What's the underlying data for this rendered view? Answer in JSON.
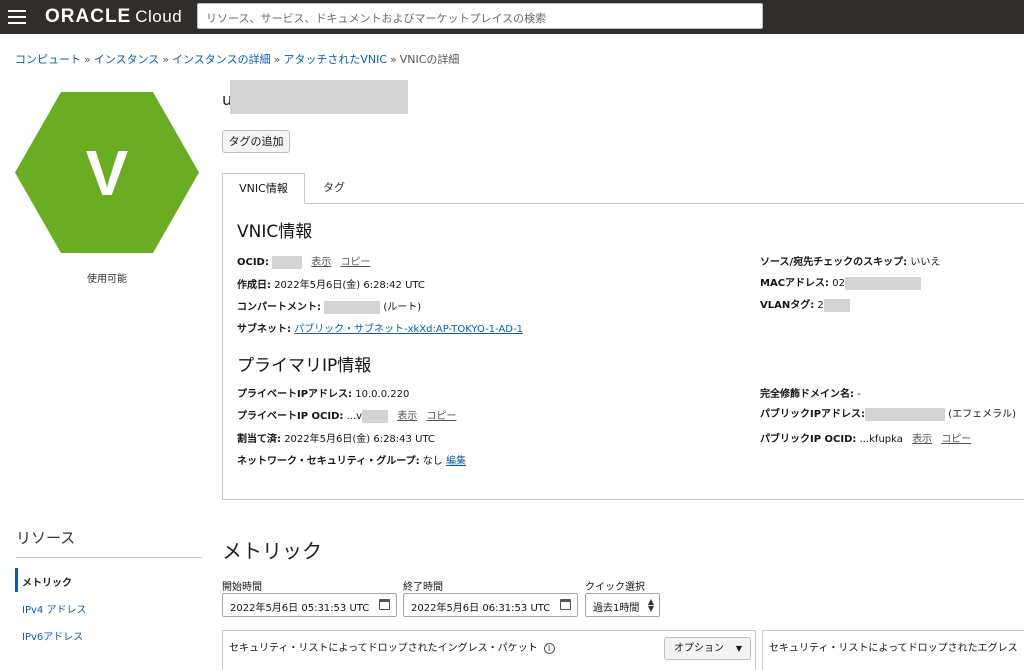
{
  "header": {
    "logo_brand": "ORACLE",
    "logo_product": "Cloud",
    "search_placeholder": "リソース、サービス、ドキュメントおよびマーケットプレイスの検索"
  },
  "breadcrumb": [
    {
      "label": "コンピュート"
    },
    {
      "label": "インスタンス"
    },
    {
      "label": "インスタンスの詳細"
    },
    {
      "label": "アタッチされたVNIC"
    },
    {
      "label": "VNICの詳細"
    }
  ],
  "breadcrumb_separator": "»",
  "hero": {
    "letter": "V",
    "status": "使用可能",
    "title_initial": "u",
    "color": "#6aad22"
  },
  "add_tag_button": "タグの追加",
  "tabs": [
    {
      "label": "VNIC情報"
    },
    {
      "label": "タグ"
    }
  ],
  "vnic_info": {
    "heading": "VNIC情報",
    "ocid_label": "OCID:",
    "show": "表示",
    "copy": "コピー",
    "created_label": "作成日:",
    "created_value": "2022年5月6日(金) 6:28:42 UTC",
    "compartment_label": "コンパートメント:",
    "compartment_suffix": "(ルート)",
    "subnet_label": "サブネット:",
    "subnet_value": "パブリック・サブネット-xkXd:AP-TOKYO-1-AD-1",
    "src_dst_label": "ソース/宛先チェックのスキップ:",
    "src_dst_value": "いいえ",
    "mac_label": "MACアドレス:",
    "mac_prefix": "02",
    "vlan_label": "VLANタグ:",
    "vlan_prefix": "2"
  },
  "primary_ip": {
    "heading": "プライマリIP情報",
    "private_ip_label": "プライベートIPアドレス:",
    "private_ip_value": "10.0.0.220",
    "private_ocid_label": "プライベートIP OCID:",
    "private_ocid_prefix": "...v",
    "show": "表示",
    "copy": "コピー",
    "assigned_label": "割当て済:",
    "assigned_value": "2022年5月6日(金) 6:28:43 UTC",
    "nsg_label": "ネットワーク・セキュリティ・グループ:",
    "nsg_value": "なし",
    "nsg_edit": "編集",
    "fqdn_label": "完全修飾ドメイン名:",
    "fqdn_value": "-",
    "public_ip_label": "パブリックIPアドレス:",
    "public_ip_suffix": "(エフェメラル)",
    "public_ocid_label": "パブリックIP OCID:",
    "public_ocid_value": "...kfupka",
    "public_show": "表示",
    "public_copy": "コピー"
  },
  "resources": {
    "title": "リソース",
    "items": [
      {
        "label": "メトリック"
      },
      {
        "label": "IPv4 アドレス"
      },
      {
        "label": "IPv6アドレス"
      }
    ]
  },
  "metrics": {
    "title": "メトリック",
    "start_label": "開始時間",
    "start_value": "2022年5月6日 05:31:53 UTC",
    "end_label": "終了時間",
    "end_value": "2022年5月6日 06:31:53 UTC",
    "quick_label": "クイック選択",
    "quick_value": "過去1時間",
    "card1_title": "セキュリティ・リストによってドロップされたイングレス・パケット",
    "card1_info": "i",
    "options_label": "オプション",
    "card2_title": "セキュリティ・リストによってドロップされたエグレス"
  }
}
